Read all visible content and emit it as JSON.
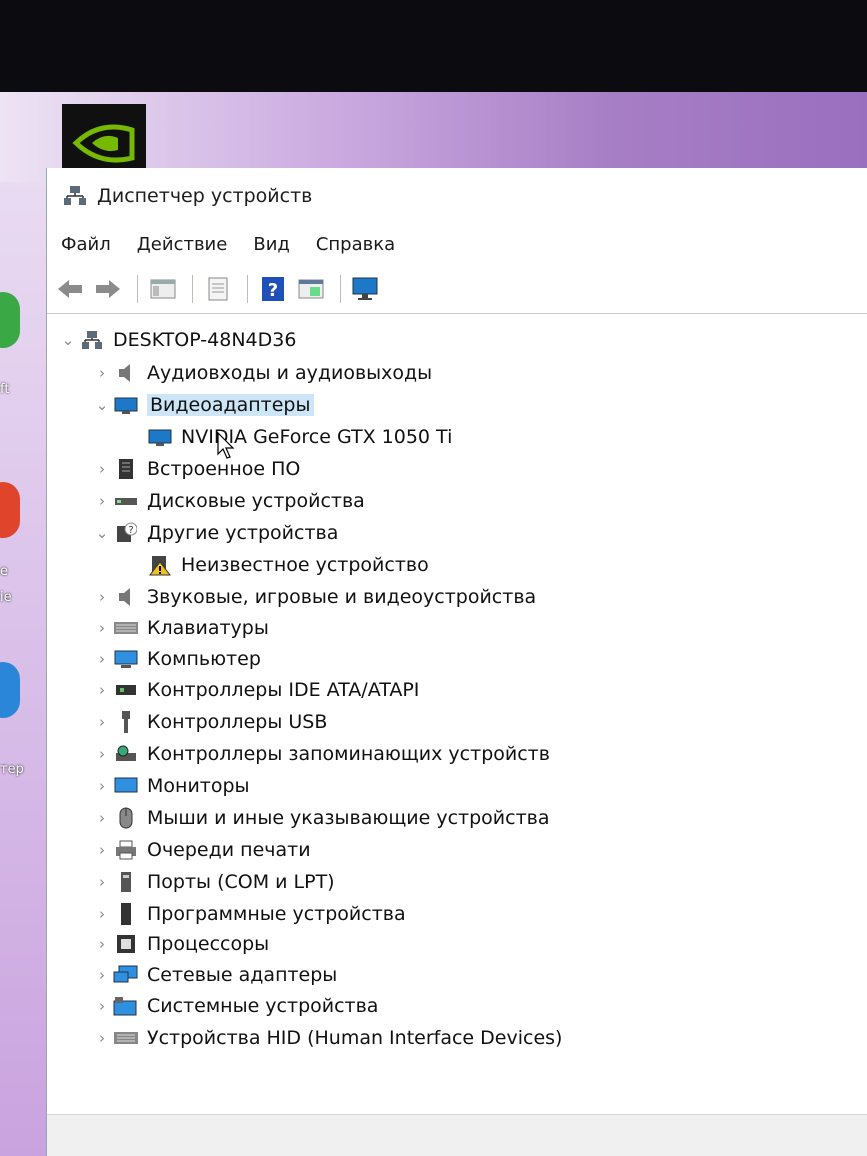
{
  "window": {
    "title": "Диспетчер устройств",
    "menu": [
      "Файл",
      "Действие",
      "Вид",
      "Справка"
    ]
  },
  "toolbar": {
    "buttons": [
      "back-arrow-icon",
      "forward-arrow-icon",
      "show-hide-tree-icon",
      "properties-icon",
      "help-icon",
      "view-resources-icon",
      "monitor-scan-icon"
    ]
  },
  "tree": {
    "root": "DESKTOP-48N4D36",
    "items": [
      {
        "label": "Аудиовходы и аудиовыходы",
        "expanded": false,
        "icon": "speaker-icon"
      },
      {
        "label": "Видеоадаптеры",
        "expanded": true,
        "icon": "display-adapter-icon",
        "selected": true
      },
      {
        "label": "NVIDIA GeForce GTX 1050 Ti",
        "child": true,
        "icon": "display-adapter-icon"
      },
      {
        "label": "Встроенное ПО",
        "expanded": false,
        "icon": "firmware-icon"
      },
      {
        "label": "Дисковые устройства",
        "expanded": false,
        "icon": "disk-icon"
      },
      {
        "label": "Другие устройства",
        "expanded": true,
        "icon": "unknown-device-icon"
      },
      {
        "label": "Неизвестное устройство",
        "child": true,
        "icon": "warning-device-icon"
      },
      {
        "label": "Звуковые, игровые и видеоустройства",
        "expanded": false,
        "icon": "speaker-icon"
      },
      {
        "label": "Клавиатуры",
        "expanded": false,
        "icon": "keyboard-icon"
      },
      {
        "label": "Компьютер",
        "expanded": false,
        "icon": "computer-icon"
      },
      {
        "label": "Контроллеры IDE ATA/ATAPI",
        "expanded": false,
        "icon": "ide-controller-icon"
      },
      {
        "label": "Контроллеры USB",
        "expanded": false,
        "icon": "usb-icon"
      },
      {
        "label": "Контроллеры запоминающих устройств",
        "expanded": false,
        "icon": "storage-controller-icon"
      },
      {
        "label": "Мониторы",
        "expanded": false,
        "icon": "monitor-icon"
      },
      {
        "label": "Мыши и иные указывающие устройства",
        "expanded": false,
        "icon": "mouse-icon"
      },
      {
        "label": "Очереди печати",
        "expanded": false,
        "icon": "printer-icon"
      },
      {
        "label": "Порты (COM и LPT)",
        "expanded": false,
        "icon": "port-icon"
      },
      {
        "label": "Программные устройства",
        "expanded": false,
        "icon": "software-device-icon"
      },
      {
        "label": "Процессоры",
        "expanded": false,
        "icon": "processor-icon"
      },
      {
        "label": "Сетевые адаптеры",
        "expanded": false,
        "icon": "network-adapter-icon"
      },
      {
        "label": "Системные устройства",
        "expanded": false,
        "icon": "system-device-icon"
      },
      {
        "label": "Устройства HID (Human Interface Devices)",
        "expanded": false,
        "icon": "hid-icon"
      }
    ]
  },
  "colors": {
    "selection": "#cde6f7",
    "accent": "#1e78c8",
    "nvidia_green": "#76b900"
  }
}
